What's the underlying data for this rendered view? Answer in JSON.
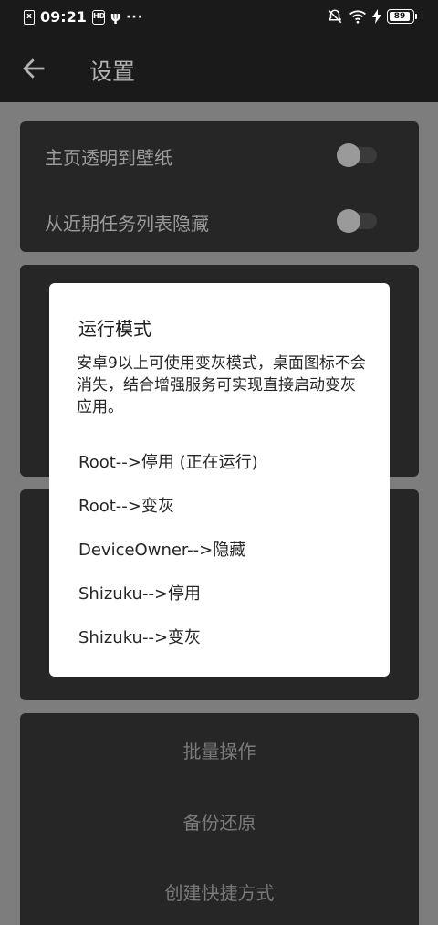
{
  "status_bar": {
    "time": "09:21",
    "sim_label": "x",
    "hd_label": "HD",
    "more": "···",
    "battery": "89"
  },
  "app_bar": {
    "title": "设置"
  },
  "settings": {
    "items": [
      {
        "label": "主页透明到壁纸",
        "enabled": false
      },
      {
        "label": "从近期任务列表隐藏",
        "enabled": false
      }
    ],
    "actions": [
      "批量操作",
      "备份还原",
      "创建快捷方式"
    ]
  },
  "dialog": {
    "title": "运行模式",
    "message": "安卓9以上可使用变灰模式，桌面图标不会消失，结合增强服务可实现直接启动变灰应用。",
    "options": [
      "Root-->停用 (正在运行)",
      "Root-->变灰",
      "DeviceOwner-->隐藏",
      "Shizuku-->停用",
      "Shizuku-->变灰"
    ]
  }
}
